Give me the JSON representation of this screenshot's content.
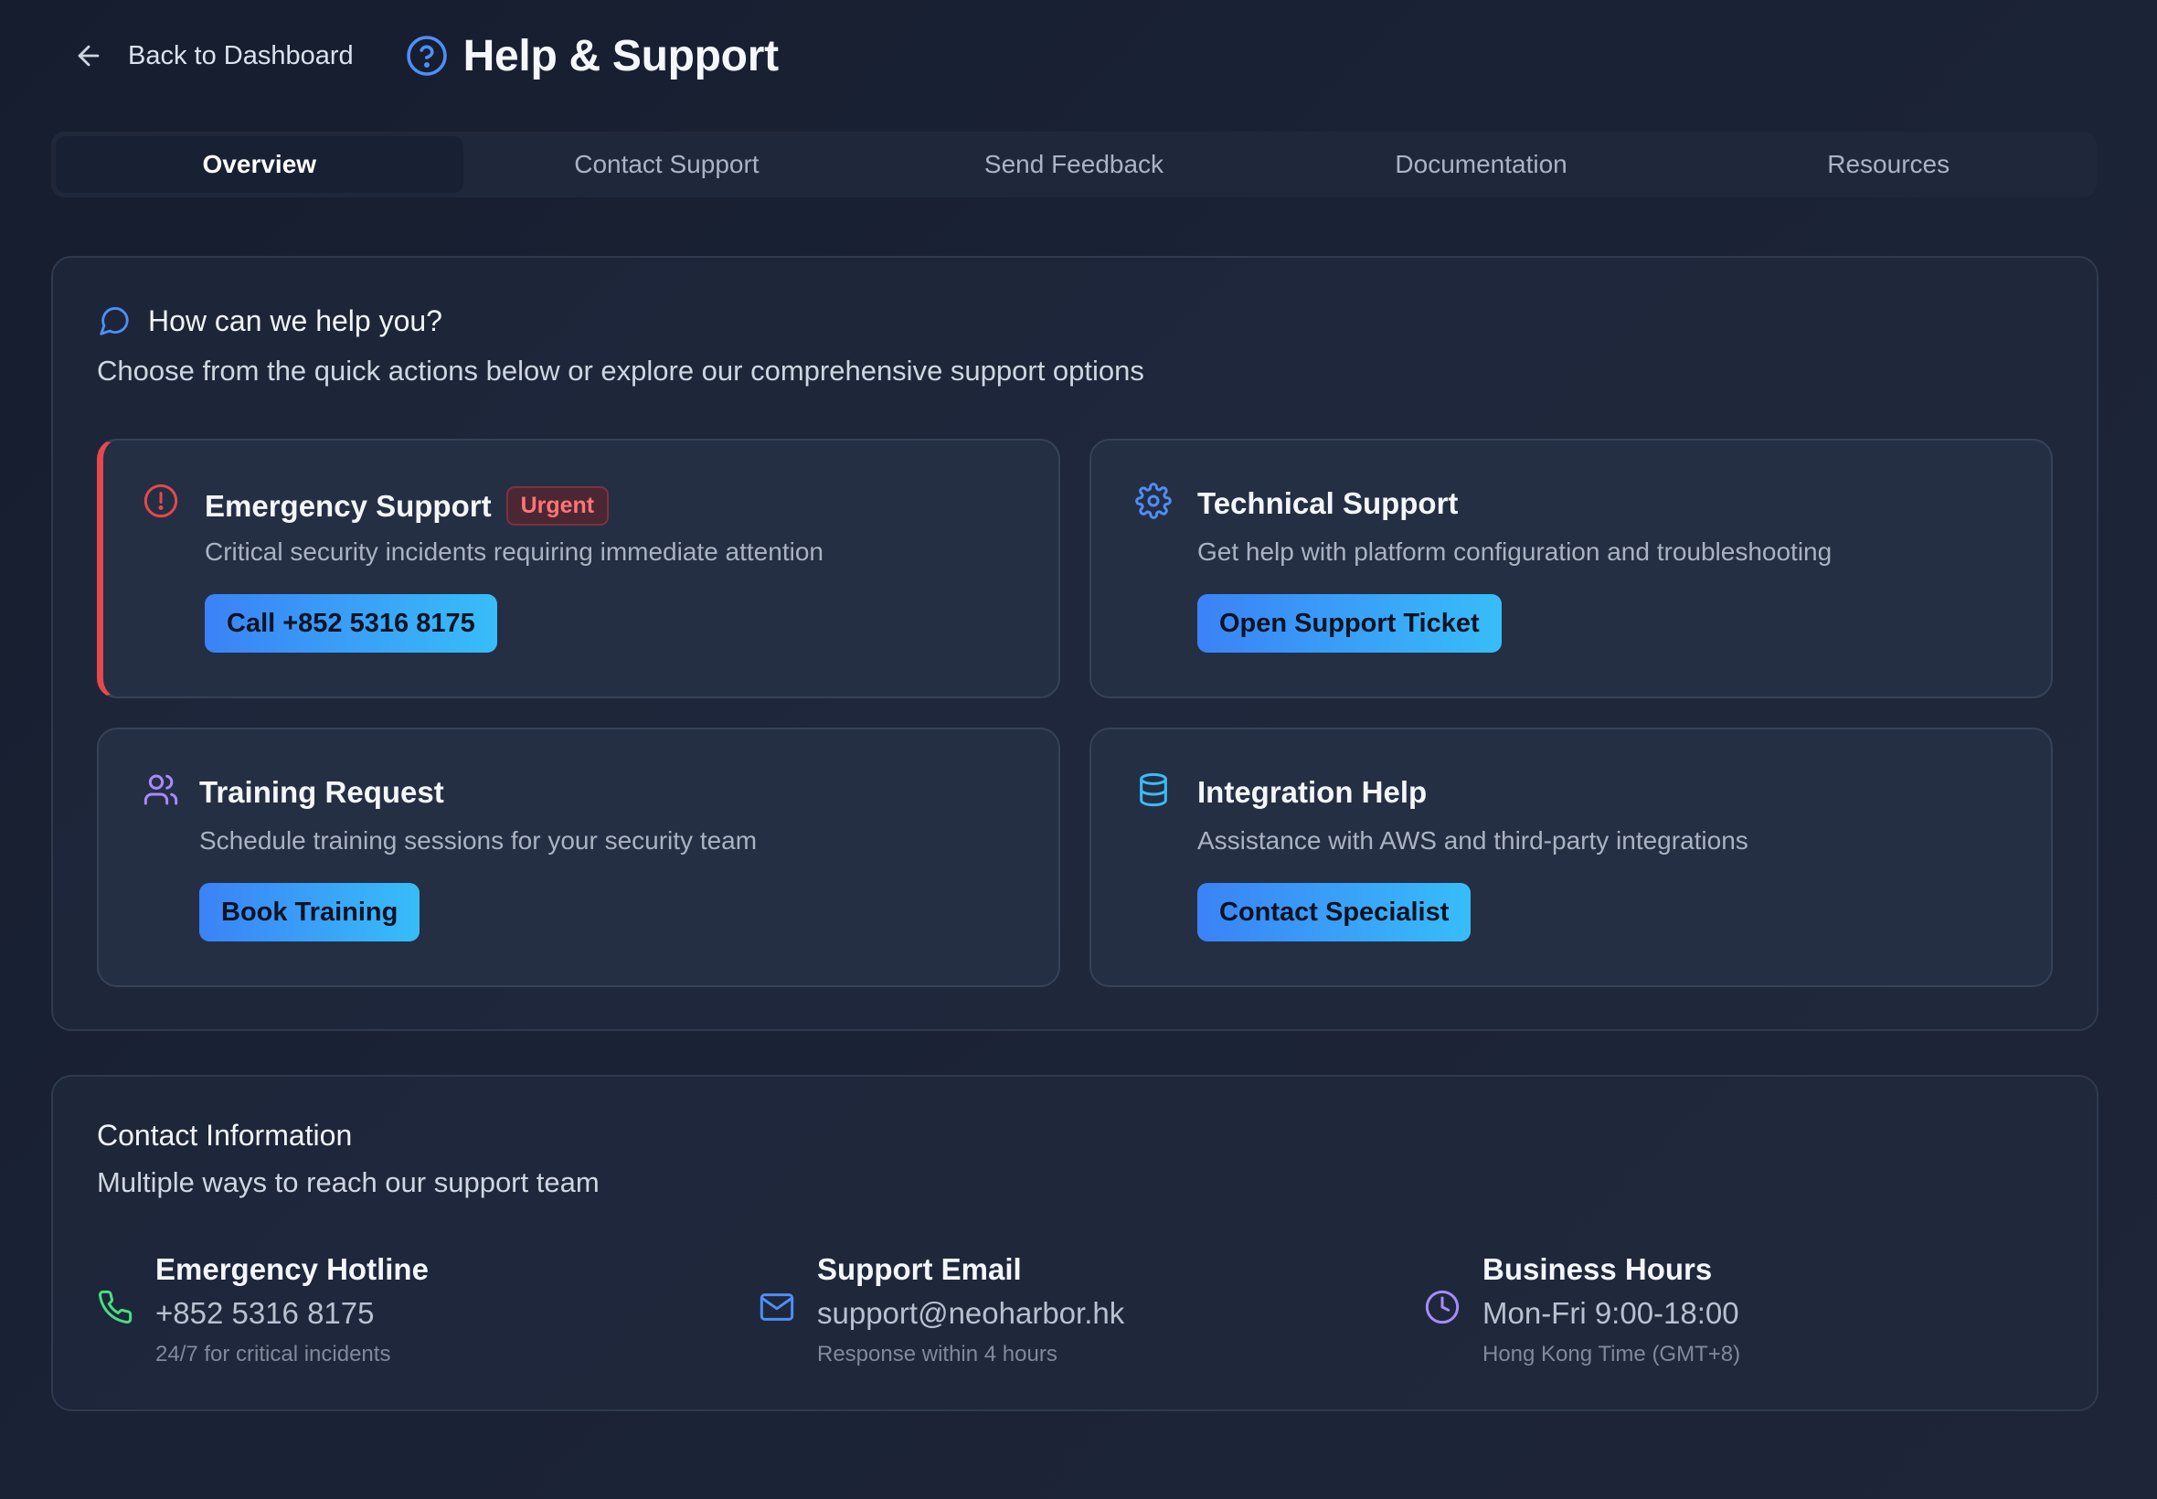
{
  "colors": {
    "accent_blue": "#3b82f6",
    "accent_cyan": "#38bdf8",
    "urgent_red": "#e5484d",
    "success_green": "#4ade80",
    "purple": "#a78bfa"
  },
  "header": {
    "back_label": "Back to Dashboard",
    "back_icon": "arrow-left-icon",
    "title_icon": "help-circle-icon",
    "title": "Help & Support"
  },
  "tabs": [
    {
      "label": "Overview",
      "active": true
    },
    {
      "label": "Contact Support",
      "active": false
    },
    {
      "label": "Send Feedback",
      "active": false
    },
    {
      "label": "Documentation",
      "active": false
    },
    {
      "label": "Resources",
      "active": false
    }
  ],
  "help": {
    "icon": "message-circle-icon",
    "title": "How can we help you?",
    "description": "Choose from the quick actions below or explore our comprehensive support options",
    "actions": [
      {
        "icon": "alert-circle-icon",
        "title": "Emergency Support",
        "badge": "Urgent",
        "description": "Critical security incidents requiring immediate attention",
        "button": "Call +852 5316 8175"
      },
      {
        "icon": "settings-icon",
        "title": "Technical Support",
        "description": "Get help with platform configuration and troubleshooting",
        "button": "Open Support Ticket"
      },
      {
        "icon": "users-icon",
        "title": "Training Request",
        "description": "Schedule training sessions for your security team",
        "button": "Book Training"
      },
      {
        "icon": "database-icon",
        "title": "Integration Help",
        "description": "Assistance with AWS and third-party integrations",
        "button": "Contact Specialist"
      }
    ]
  },
  "contact": {
    "title": "Contact Information",
    "description": "Multiple ways to reach our support team",
    "items": [
      {
        "icon": "phone-icon",
        "label": "Emergency Hotline",
        "value": "+852 5316 8175",
        "note": "24/7 for critical incidents"
      },
      {
        "icon": "mail-icon",
        "label": "Support Email",
        "value": "support@neoharbor.hk",
        "note": "Response within 4 hours"
      },
      {
        "icon": "clock-icon",
        "label": "Business Hours",
        "value": "Mon-Fri 9:00-18:00",
        "note": "Hong Kong Time (GMT+8)"
      }
    ]
  }
}
